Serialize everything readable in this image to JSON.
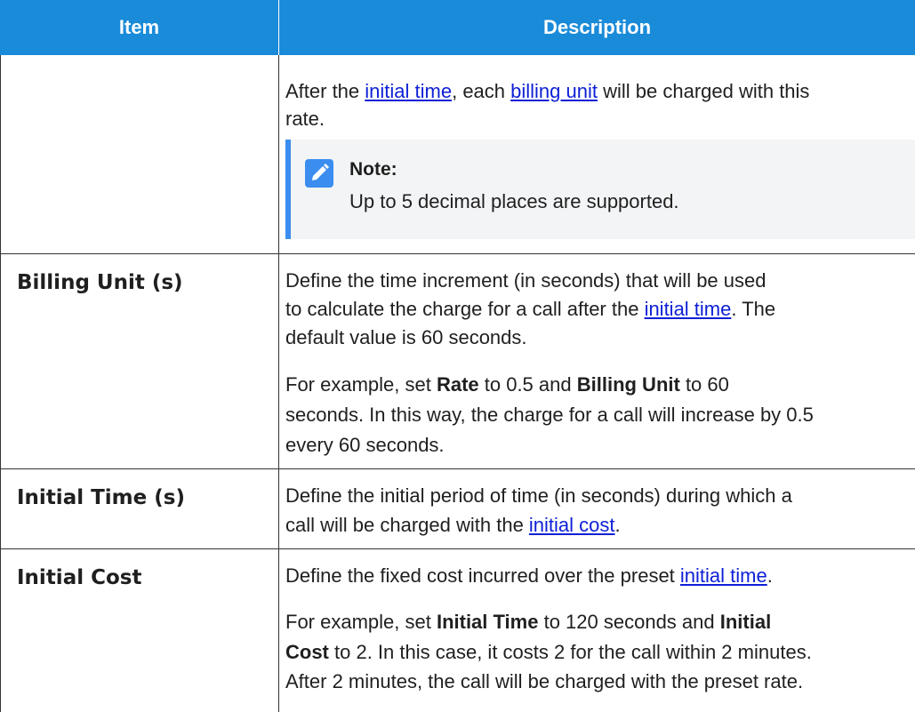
{
  "header": {
    "item": "Item",
    "description": "Description"
  },
  "rate_row": {
    "line1_a": "After the ",
    "link1": "initial time",
    "line1_b": ", each ",
    "link2": "billing unit",
    "line1_c": " will be charged with this",
    "line2": "rate.",
    "note_title": "Note:",
    "note_body": "Up to 5 decimal places are supported.",
    "note_icon": "edit-pencil-icon"
  },
  "billing_row": {
    "item": "Billing Unit (s)",
    "p1_l1": "Define the time increment (in seconds) that will be used",
    "p1_l2_a": "to calculate the charge for a call after the ",
    "p1_l2_link": "initial time",
    "p1_l2_b": ". The",
    "p1_l3": "default value is 60 seconds.",
    "p2_l1_a": "For example, set ",
    "p2_l1_b1": "Rate",
    "p2_l1_c": " to 0.5 and ",
    "p2_l1_b2": "Billing Unit",
    "p2_l1_d": " to 60",
    "p2_l2": "seconds. In this way, the charge for a call will increase by 0.5",
    "p2_l3": "every 60 seconds."
  },
  "initial_time_row": {
    "item": "Initial Time (s)",
    "l1": "Define the initial period of time (in seconds) during which a",
    "l2_a": "call will be charged with the ",
    "l2_link": "initial cost",
    "l2_b": "."
  },
  "initial_cost_row": {
    "item": "Initial Cost",
    "p1_a": "Define the fixed cost incurred over the preset ",
    "p1_link": "initial time",
    "p1_b": ".",
    "p2_l1_a": "For example, set ",
    "p2_l1_b1": "Initial Time",
    "p2_l1_c": " to 120 seconds and ",
    "p2_l1_b2": "Initial",
    "p2_l2_b": "Cost",
    "p2_l2_c": " to 2. In this case, it costs 2 for the call within 2 minutes.",
    "p2_l3": "After 2 minutes, the call will be charged with the preset rate."
  }
}
